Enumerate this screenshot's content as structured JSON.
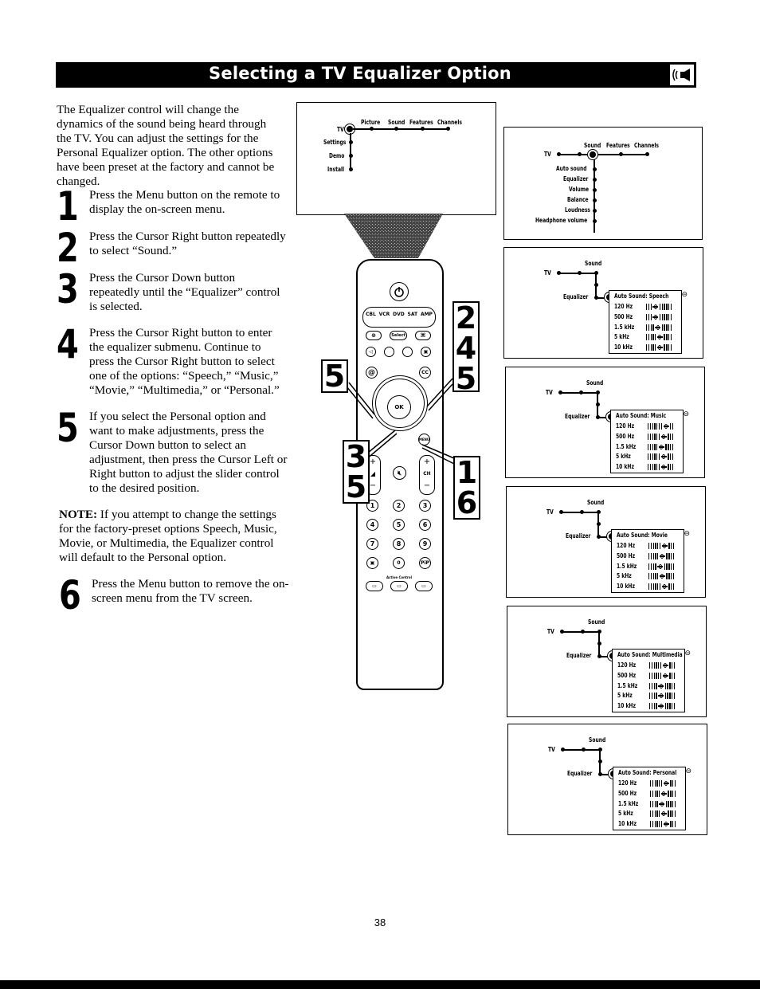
{
  "header": {
    "title": "Selecting a TV Equalizer Option",
    "icon": "speaker-sound-icon"
  },
  "intro": "The Equalizer control will change the dynamics of the sound being heard through the TV. You can adjust the settings for the Personal Equalizer option. The other options have been preset at the factory and cannot be changed.",
  "steps": [
    {
      "number": "1",
      "text": "Press the Menu button on the remote to display the on-screen menu."
    },
    {
      "number": "2",
      "text": "Press the Cursor Right button repeatedly to select “Sound.”"
    },
    {
      "number": "3",
      "text": "Press the Cursor Down button repeatedly until the “Equalizer” control is selected."
    },
    {
      "number": "4",
      "text": "Press the Cursor Right button to enter the equalizer submenu. Continue to press the Cursor Right button to select one of the options: “Speech,” “Music,” “Movie,” “Multimedia,” or “Personal.”"
    },
    {
      "number": "5",
      "text": "If you select the Personal option and want to make adjustments, press the Cursor Down button to select an adjustment, then press the Cursor Left or Right button to adjust the slider control to the desired position."
    },
    {
      "number": "6",
      "text": "Press the Menu button to remove the on-screen menu from the TV screen."
    }
  ],
  "note": {
    "label": "NOTE:",
    "text": " If you attempt to change the settings for the factory-preset options Speech, Music, Movie, or Multimedia, the Equalizer control will default to the Personal option."
  },
  "main_menu": {
    "root": "TV",
    "top_items": [
      "Picture",
      "Sound",
      "Features",
      "Channels"
    ],
    "side_items": [
      "Settings",
      "Demo",
      "Install"
    ]
  },
  "sound_menu": {
    "root": "TV",
    "top_items": [
      "Sound",
      "Features",
      "Channels"
    ],
    "side_items": [
      "Auto sound",
      "Equalizer",
      "Volume",
      "Balance",
      "Loudness",
      "Headphone volume"
    ]
  },
  "eq_bands": [
    "120 Hz",
    "500 Hz",
    "1.5 kHz",
    "5 kHz",
    "10 kHz"
  ],
  "eq_panels": [
    {
      "root": "TV",
      "menu": "Sound",
      "item": "Equalizer",
      "title": "Auto Sound: Speech",
      "levels": [
        3,
        3,
        4,
        5,
        5
      ]
    },
    {
      "root": "TV",
      "menu": "Sound",
      "item": "Equalizer",
      "title": "Auto Sound: Music",
      "levels": [
        7,
        6,
        5,
        6,
        6
      ]
    },
    {
      "root": "TV",
      "menu": "Sound",
      "item": "Equalizer",
      "title": "Auto Sound: Movie",
      "levels": [
        6,
        5,
        4,
        5,
        6
      ]
    },
    {
      "root": "TV",
      "menu": "Sound",
      "item": "Equalizer",
      "title": "Auto Sound: Multimedia",
      "levels": [
        6,
        6,
        4,
        4,
        4
      ]
    },
    {
      "root": "TV",
      "menu": "Sound",
      "item": "Equalizer",
      "title": "Auto Sound: Personal",
      "levels": [
        6,
        5,
        4,
        5,
        6
      ]
    }
  ],
  "eq_slider_steps": 10,
  "remote": {
    "source_buttons": [
      "CBL",
      "VCR",
      "DVD",
      "SAT",
      "AMP"
    ],
    "select_label": "Select",
    "ok_label": "OK",
    "menu_label": "MENU",
    "cc_label": "CC",
    "ch_label": "CH",
    "plus": "+",
    "minus": "−",
    "digits": [
      "1",
      "2",
      "3",
      "4",
      "5",
      "6",
      "7",
      "8",
      "9",
      "0"
    ],
    "pip_label": "PiP",
    "active_control_label": "Active Control"
  },
  "callouts": {
    "right_top": [
      "2",
      "4",
      "5"
    ],
    "left_top": [
      "5"
    ],
    "left_bottom": [
      "3",
      "5"
    ],
    "right_bottom": [
      "1",
      "6"
    ]
  },
  "page_number": "38"
}
